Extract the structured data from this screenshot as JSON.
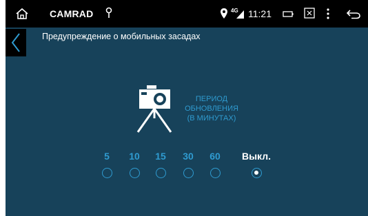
{
  "statusbar": {
    "app_name": "CAMRAD",
    "network": "4G",
    "time": "11:21"
  },
  "header": {
    "title": "Предупреждение о мобильных засадах"
  },
  "period": {
    "line1": "ПЕРИОД",
    "line2": "ОБНОВЛЕНИЯ",
    "line3": "(В МИНУТАХ)"
  },
  "options": [
    {
      "label": "5",
      "selected": false
    },
    {
      "label": "10",
      "selected": false
    },
    {
      "label": "15",
      "selected": false
    },
    {
      "label": "30",
      "selected": false
    },
    {
      "label": "60",
      "selected": false
    },
    {
      "label": "Выкл.",
      "selected": true
    }
  ],
  "colors": {
    "background": "#17425a",
    "accent": "#2f9bd0",
    "statusbar": "#000000"
  }
}
